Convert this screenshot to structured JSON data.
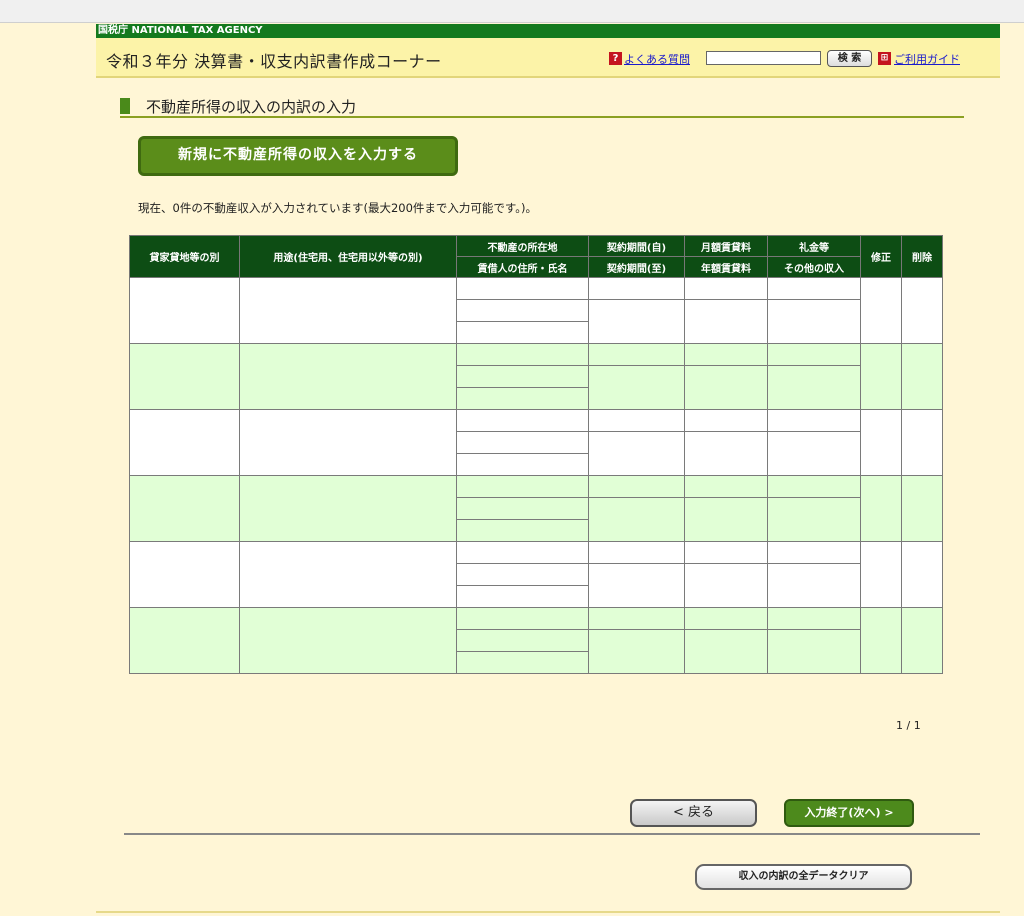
{
  "agency": "国税庁 NATIONAL TAX AGENCY",
  "header": {
    "title": "令和３年分 決算書・収支内訳書作成コーナー",
    "faq_icon": "?",
    "faq_link": "よくある質問",
    "search_value": "",
    "search_button": "検 索",
    "guide_icon": "⊞",
    "guide_link": "ご利用ガイド"
  },
  "section": {
    "title": "不動産所得の収入の内訳の入力",
    "new_button": "新規に不動産所得の収入を入力する",
    "count_text": "現在、0件の不動産収入が入力されています(最大200件まで入力可能です。)。"
  },
  "table": {
    "headers": {
      "lender_type": "貸家貸地等の別",
      "usage": "用途(住宅用、住宅用以外等の別)",
      "location": "不動産の所在地",
      "tenant": "賃借人の住所・氏名",
      "contract_from": "契約期間(自)",
      "contract_to": "契約期間(至)",
      "monthly_rent": "月額賃貸料",
      "annual_rent": "年額賃貸料",
      "key_money": "礼金等",
      "other_income": "その他の収入",
      "edit": "修正",
      "delete": "削除"
    },
    "record_count": 6
  },
  "pagination": "1 / 1",
  "buttons": {
    "back": "<   戻る",
    "next": "入力終了(次へ) >",
    "clear": "収入の内訳の全データクリア"
  },
  "colors": {
    "header_green": "#0d4d14",
    "row_green": "#e1ffd6",
    "page_bg": "#fff6d6",
    "title_bar": "#fcf3a8",
    "agency_bar": "#147a1e"
  }
}
